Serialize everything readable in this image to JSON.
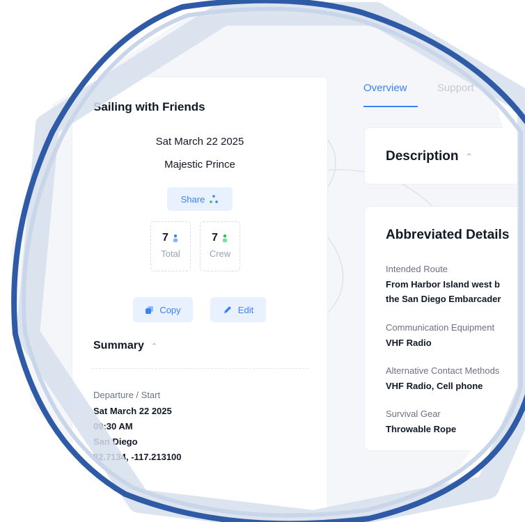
{
  "trip": {
    "title": "Sailing with Friends",
    "date": "Sat March 22 2025",
    "vessel": "Majestic Prince",
    "share_label": "Share",
    "stats": [
      {
        "value": "7",
        "label": "Total"
      },
      {
        "value": "7",
        "label": "Crew"
      }
    ],
    "copy_label": "Copy",
    "edit_label": "Edit"
  },
  "summary": {
    "heading": "Summary",
    "departure_label": "Departure / Start",
    "departure_lines": [
      "Sat March 22 2025",
      "09:30 AM",
      "San Diego",
      "32.7134, -117.213100"
    ]
  },
  "tabs": [
    {
      "label": "Overview"
    },
    {
      "label": "Support"
    }
  ],
  "description": {
    "heading": "Description"
  },
  "details": {
    "heading": "Abbreviated Details",
    "fields": [
      {
        "label": "Intended Route",
        "value": "From Harbor Island west b",
        "value2": "the San Diego Embarcader"
      },
      {
        "label": "Communication Equipment",
        "value": "VHF Radio"
      },
      {
        "label": "Alternative Contact Methods",
        "value": "VHF Radio, Cell phone"
      },
      {
        "label": "Survival Gear",
        "value": "Throwable Rope"
      }
    ]
  },
  "colors": {
    "accent": "#3b82f6",
    "accent_bg": "#e8f1fd",
    "ring_dark": "#2f5aa6",
    "ring_light": "#c9d6ea"
  },
  "icons": [
    "share-icon",
    "person-icon",
    "crew-icon",
    "copy-icon",
    "edit-icon",
    "chevron-up-icon"
  ]
}
